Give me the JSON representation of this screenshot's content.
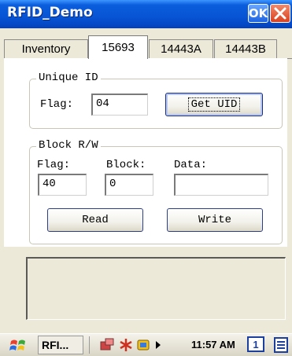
{
  "window": {
    "title": "RFID_Demo",
    "ok_label": "OK"
  },
  "tabs": [
    {
      "label": "Inventory",
      "active": false
    },
    {
      "label": "15693",
      "active": true
    },
    {
      "label": "14443A",
      "active": false
    },
    {
      "label": "14443B",
      "active": false
    }
  ],
  "unique_id": {
    "group_title": "Unique ID",
    "flag_label": "Flag:",
    "flag_value": "04",
    "get_uid_label": "Get UID"
  },
  "block_rw": {
    "group_title": "Block R/W",
    "flag_label": "Flag:",
    "block_label": "Block:",
    "data_label": "Data:",
    "flag_value": "40",
    "block_value": "0",
    "data_value": "",
    "read_label": "Read",
    "write_label": "Write"
  },
  "taskbar": {
    "app_button": "RFI...",
    "clock": "11:57 AM",
    "desktop_number": "1"
  },
  "colors": {
    "titlebar": "#0856d6",
    "window_bg": "#ece9d8",
    "close": "#d9421f"
  }
}
